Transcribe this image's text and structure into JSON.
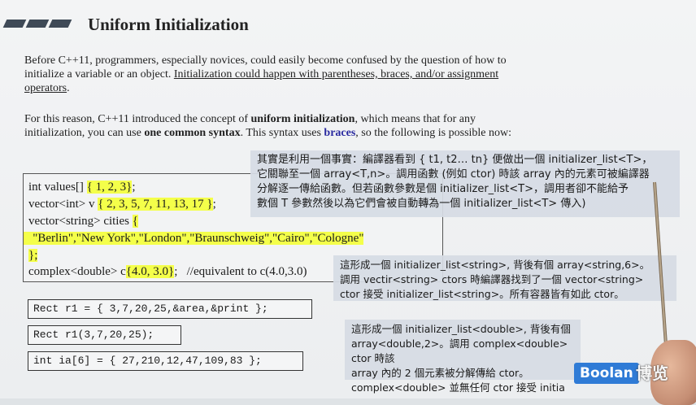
{
  "slide": {
    "title": "Uniform Initialization",
    "para1": {
      "t1": "Before C++11, programmers, especially novices, could easily become confused by the question of how to initialize a variable or an object. ",
      "t2": "Initialization could happen with parentheses, braces, and/or assignment operators",
      "t3": "."
    },
    "para2": {
      "t1": "For this reason, C++11 introduced the concept of ",
      "b1": "uniform initialization",
      "t2": ", which means that for any initialization, you can use ",
      "b2": "one common syntax",
      "t3": ". This syntax uses ",
      "b3": "braces",
      "t4": ",  so the following is possible now:"
    },
    "code": {
      "l1a": "int values[] ",
      "l1b": "{ 1, 2, 3}",
      "l1c": ";",
      "l2a": "vector<int> v ",
      "l2b": "{ 2, 3, 5, 7, 11, 13, 17 }",
      "l2c": ";",
      "l3a": "vector<string> cities ",
      "l3b": "{",
      "l4": "   \"Berlin\",\"New York\",\"London\",\"Braunschweig\",\"Cairo\",\"Cologne\"",
      "l5": "};",
      "l6a": "complex<double> c",
      "l6b": "{4.0, 3.0}",
      "l6c": ";   //equivalent to c(4.0,3.0)"
    },
    "mono": [
      "Rect r1 = { 3,7,20,25,&area,&print };",
      "Rect r1(3,7,20,25);",
      "int ia[6] = { 27,210,12,47,109,83 };"
    ]
  },
  "notes": {
    "n1": "其實是利用一個事實：編譯器看到 { t1, t2… tn} 便做出一個 initializer_list<T>，\n它關聯至一個 array<T,n>。調用函數 (例如 ctor) 時該 array 內的元素可被編譯器\n分解逐一傳給函數。但若函數參數是個 initializer_list<T>，調用者卻不能給予\n數個 T 參數然後以為它們會被自動轉為一個 initializer_list<T> 傳入)",
    "n2": "這形成一個 initializer_list<string>, 背後有個 array<string,6>。\n調用 vectir<string> ctors 時編譯器找到了一個 vector<string>\nctor 接受 initializer_list<string>。所有容器皆有如此 ctor。",
    "n3": "這形成一個 initializer_list<double>, 背後有個\narray<double,2>。調用 complex<double> ctor 時該\narray 內的 2 個元素被分解傳給 ctor。\ncomplex<double> 並無任何 ctor 接受 initia"
  },
  "logo": {
    "text": "Boolan",
    "cn": "博览"
  }
}
